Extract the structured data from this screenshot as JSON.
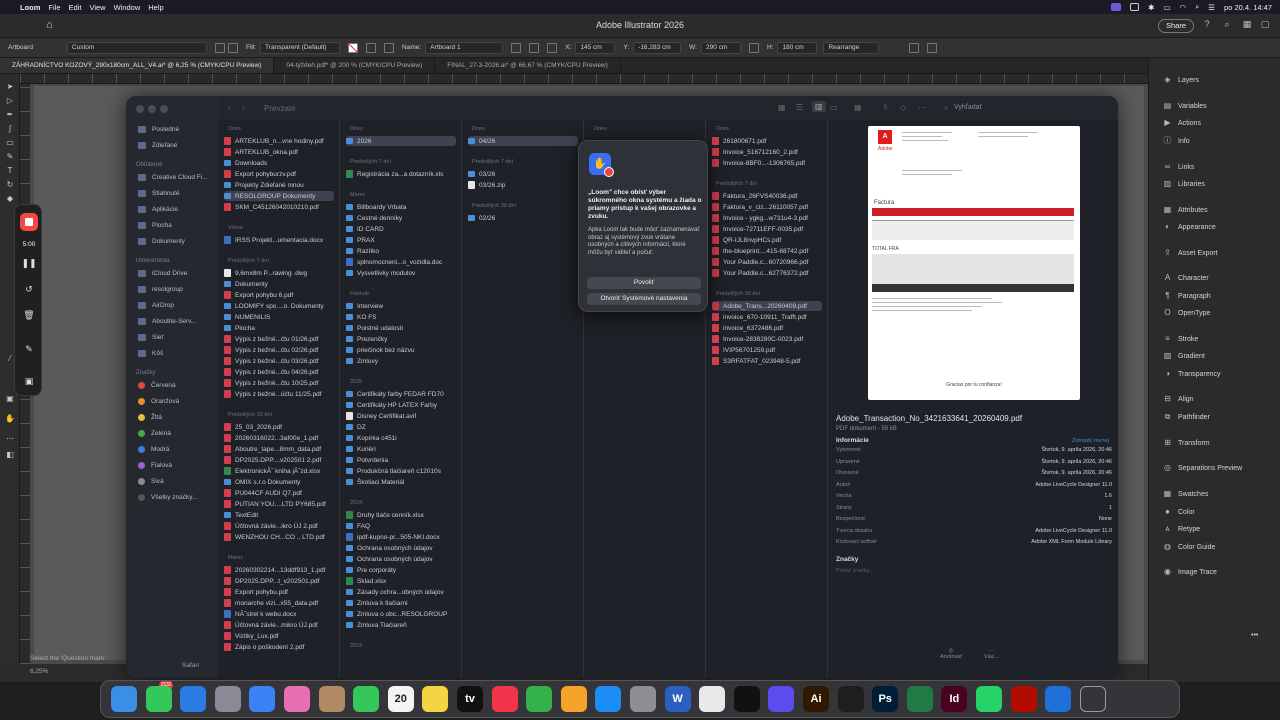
{
  "menubar": {
    "apple": "",
    "app": "Loom",
    "items": [
      "File",
      "Edit",
      "View",
      "Window",
      "Help"
    ],
    "clock": "po 20.4. 14:47"
  },
  "illustrator": {
    "title": "Adobe Illustrator 2026",
    "share": "Share",
    "control": {
      "artboard_label": "Artboard",
      "preset": "Custom",
      "fill_label": "Fill:",
      "fill_value": "Transparent (Default)",
      "name_label": "Name:",
      "name_value": "Artboard 1",
      "x_label": "X:",
      "x_value": "145 cm",
      "y_label": "Y:",
      "y_value": "-16,283 cm",
      "w_label": "W:",
      "w_value": "290 cm",
      "h_label": "H:",
      "h_value": "180 cm",
      "rearrange": "Rearrange"
    },
    "tabs": [
      "ZÁHRADNÍCTVO KOZOVÝ_290x180cm_ALL_V4.ai* @ 6,25 % (CMYK/CPU Preview)",
      "04-týždeň.pdf* @ 200 % (CMYK/CPU Preview)",
      "FINAL_27-3-2026.ai* @ 66,67 % (CMYK/CPU Preview)"
    ],
    "status": {
      "zoom": "6,25%",
      "hint": "Select the 'Question mark'"
    },
    "panels": [
      "Layers",
      "Variables",
      "Actions",
      "Info",
      "Links",
      "Libraries",
      "Attributes",
      "Appearance",
      "Asset Export",
      "Character",
      "Paragraph",
      "OpenType",
      "Stroke",
      "Gradient",
      "Transparency",
      "Align",
      "Pathfinder",
      "Transform",
      "Separations Preview",
      "Swatches",
      "Color",
      "Retype",
      "Color Guide",
      "Image Trace"
    ]
  },
  "loom": {
    "time": "5:00"
  },
  "finder": {
    "title": "Prevzaté",
    "search": "Vyhľadať",
    "sidebar": {
      "top": [
        "Posledné",
        "Zdieľané"
      ],
      "sec_places": "Obľúbené",
      "places": [
        "Creative Cloud Fi...",
        "Stiahnuté",
        "Aplikácie",
        "Plocha",
        "Dokumenty"
      ],
      "sec_locations": "Umiestnenia",
      "locations": [
        "iCloud Drive",
        "resolgroup",
        "AirDrop",
        "Aboutite-Serv...",
        "Sieť",
        "Kôš"
      ],
      "sec_tags": "Značky",
      "tags": [
        {
          "name": "Červená",
          "color": "#e0483e"
        },
        {
          "name": "Oranžová",
          "color": "#e8902f"
        },
        {
          "name": "Žltá",
          "color": "#e3c531"
        },
        {
          "name": "Zelená",
          "color": "#3fae4a"
        },
        {
          "name": "Modrá",
          "color": "#3a7ee0"
        },
        {
          "name": "Fialová",
          "color": "#a35bd6"
        },
        {
          "name": "Sivá",
          "color": "#8c8c8c"
        },
        {
          "name": "Všetky značky...",
          "color": "#555555"
        }
      ],
      "footer": "Safari"
    },
    "col1": {
      "h1": "Dnes",
      "g1": [
        "ARTEKLUB_n...vne hodiny.pdf",
        "ARTEKLUB_okna.pdf",
        "Downloads",
        "Export pohyburzv.pdf",
        "Projekty  Zdieľané mnou",
        "RESOLGROUP Dokumenty",
        "SKM_C45126042010210.pdf"
      ],
      "h2": "Včera",
      "g2": [
        "IRSS Projekt...umentacia.docx"
      ],
      "h3": "Predošlých 7 dní",
      "g3": [
        "9,6mx8m P...rawing .dwg",
        "Dokumenty",
        "Export pohybu 6.pdf",
        "LOOMIFY spo....o. Dokumenty",
        "NUMENILIS",
        "Plocha",
        "Výpis z bežné...čtu 01/26.pdf",
        "Výpis z bežné...čtu 02/26.pdf",
        "Výpis z bežné...čtu 03/26.pdf",
        "Výpis z bežné...čtu 04/26.pdf",
        "Výpis z bežné...čtu 10/25.pdf",
        "Výpis z bežné...účtu 11/25.pdf"
      ],
      "h4": "Predošlých 30 dní",
      "g4": [
        "25_03_2026.pdf",
        "20260316022...3af00e_1.pdf",
        "Aboutre_tape...8mm_data.pdf",
        "DP2025.DPP....v202501 2.pdf",
        "ElektronickĂˇ kniha jĂˇzd.xlsx",
        "OMIX s.r.o Dokumenty",
        "PU044CF AUDI Q7.pdf",
        "PUTIAN YOU....LTD PY685.pdf",
        "TextEdit",
        "Účtovná závie...ikro ÚJ 2.pdf",
        "WENZHOU CH...CO ., LTD.pdf"
      ],
      "h5": "Marec",
      "g5": [
        "20260302214...13ddf913_1.pdf",
        "DP2025.DPP...t_v202501.pdf",
        "Export pohybu.pdf",
        "monarche vizi...x55_data.pdf",
        "NĂˇstrel k webu.docx",
        "Účtovná závie...mikro ÚJ.pdf",
        "Vizitky_Lux.pdf",
        "Zápis o poškodení 2.pdf"
      ]
    },
    "col2": {
      "h1": "Dnes",
      "g1": [
        "2026"
      ],
      "h2": "Predošlých 7 dní",
      "g2": [
        "Registrácia za...a dotazník.xls"
      ],
      "h3": "Marec",
      "g3": [
        "Billboardy Vrbata",
        "Cestné denníky",
        "ID CARD",
        "PRAX",
        "Razítko",
        "splnomocneni...o_vozidla.doc",
        "Vysvetlivky modulov"
      ],
      "h4": "Február",
      "g4": [
        "Interview",
        "KO FS",
        "Poistné udalosti",
        "Prezenčky",
        "priečinok bez názvu",
        "Zmluvy"
      ],
      "h5": "2025",
      "g5": [
        "Certifikáty farby FEDAR FD70",
        "Certifikáty HP LATEX Farby",
        "Disney Certifikat.avif",
        "DZ",
        "Kopírka c451i",
        "Kuriéri",
        "Potvrdenia",
        "Produkčná tlačiareň c12010s",
        "Školiaci Materiál"
      ],
      "h6": "2024",
      "g6": [
        "Druhy tlače cenník.xlsx",
        "FAQ",
        "ipdf-kupno-pr...505-NKI.docx",
        "Ochrana osobných údajov",
        "Ochrana osobných údajov",
        "Pre corporáty",
        "Sklad.xlsx",
        "Zásady ochra...obných údajov",
        "Zmluva k tlačiarni",
        "Zmluva o obc...RESOLGROUP",
        "Zmluva Tlačiareň"
      ],
      "h7": "2023"
    },
    "col3": {
      "h1": "Dnes",
      "g1": [
        "04/26"
      ],
      "h2": "Predošlých 7 dní",
      "g2": [
        "03/26",
        "03/26.zip"
      ],
      "h3": "Predošlých 30 dní",
      "g3": [
        "02/26"
      ]
    },
    "col4": {
      "h1": "Dnes"
    },
    "col5": {
      "h1": "Dnes",
      "g1": [
        "261800671.pdf",
        "Invoice_516712160_2.pdf",
        "Invoice-8BF0...-1306765.pdf"
      ],
      "h2": "Predošlých 7 dní",
      "g2": [
        "Faktura_26FVS40036.pdf",
        "Faktura_v_ciz...26110057.pdf",
        "Invoice - ygkg...w731u4-3.pdf",
        "Invoice-72711EFF-0035.pdf",
        "QR-IJL8nvpHCs.pdf",
        "the-blueprint....415-68742.pdf",
        "Your Paddle.c...60720966.pdf",
        "Your Paddle.c...62776372.pdf"
      ],
      "h3": "Predošlých 30 dní",
      "g3": [
        "Adobe_Trans...20260409.pdf",
        "invoice_670-10911_Trafft.pdf",
        "invoice_6372486.pdf",
        "Invoice-2838280C-0023.pdf",
        "IVIP56701259.pdf",
        "S3RFATFAT_023948-5.pdf"
      ]
    },
    "dialog": {
      "title": "„Loom\" chce obísť výber súkromného okna systému a žiada o priamy prístup k vašej obrazovke a zvuku.",
      "body": "Apka Loom tak bude môcť zaznamenávať obraz aj systémový zvuk vrátane osobných a citlivých informácií, ktoré môžu byť viditeľ a počuť.",
      "allow": "Povoliť",
      "settings": "Otvoriť Systémové nastavenia"
    },
    "preview": {
      "logo": "A",
      "brand": "Adobe",
      "heading": "Factura",
      "total": "TOTAL FRA",
      "thanks": "Gracias por tu confianza!",
      "filename": "Adobe_Transaction_No_3421633641_20260409.pdf",
      "kind": "PDF dokument - 59 kB",
      "info_h": "Informácie",
      "info_more": "Zobraziť menej",
      "info": [
        {
          "k": "Vytvorené",
          "v": "Štvrtok, 9. apríla 2026, 20:46"
        },
        {
          "k": "Upravené",
          "v": "Štvrtok, 9. apríla 2026, 20:46"
        },
        {
          "k": "Otvorené",
          "v": "Štvrtok, 9. apríla 2026, 20:46"
        },
        {
          "k": "Autori",
          "v": "Adobe LiveCycle Designer 11.0"
        },
        {
          "k": "Verzia",
          "v": "1.6"
        },
        {
          "k": "Strany",
          "v": "1"
        },
        {
          "k": "Bezpečnosť",
          "v": "None"
        },
        {
          "k": "Tvorca obsahu",
          "v": "Adobe LiveCycle Designer 11.0"
        },
        {
          "k": "Kódovací softvér",
          "v": "Adobe XML Form Module Library"
        }
      ],
      "tags_h": "Značky",
      "tags_add": "Pridať značky...",
      "act1": "Anotovať",
      "act2": "Viac..."
    }
  },
  "dock": {
    "badge": "1532",
    "calendar_day": "20",
    "apps": [
      {
        "name": "finder",
        "color": "#3a8ee6",
        "glyph": ""
      },
      {
        "name": "messages",
        "color": "#34c759",
        "glyph": ""
      },
      {
        "name": "safari",
        "color": "#2a7be4",
        "glyph": ""
      },
      {
        "name": "launchpad",
        "color": "#8a8a96",
        "glyph": ""
      },
      {
        "name": "mail",
        "color": "#3b82f6",
        "glyph": ""
      },
      {
        "name": "photos",
        "color": "#e96fb3",
        "glyph": ""
      },
      {
        "name": "contacts",
        "color": "#b08a62",
        "glyph": ""
      },
      {
        "name": "facetime",
        "color": "#34c759",
        "glyph": ""
      },
      {
        "name": "calendar",
        "color": "#f4f4f4",
        "glyph": ""
      },
      {
        "name": "notes",
        "color": "#f5d442",
        "glyph": ""
      },
      {
        "name": "tv",
        "color": "#111111",
        "glyph": "tv"
      },
      {
        "name": "music",
        "color": "#f2354b",
        "glyph": ""
      },
      {
        "name": "numbers",
        "color": "#32b14a",
        "glyph": ""
      },
      {
        "name": "pages",
        "color": "#f6a32b",
        "glyph": ""
      },
      {
        "name": "app-store",
        "color": "#1e8cf5",
        "glyph": ""
      },
      {
        "name": "system-settings",
        "color": "#8e8e93",
        "glyph": ""
      },
      {
        "name": "word",
        "color": "#2b5fc0",
        "glyph": "W"
      },
      {
        "name": "preview",
        "color": "#e8e8e8",
        "glyph": ""
      },
      {
        "name": "chatgpt",
        "color": "#111111",
        "glyph": ""
      },
      {
        "name": "loom",
        "color": "#5b4cf0",
        "glyph": ""
      },
      {
        "name": "illustrator",
        "color": "#2d1a00",
        "glyph": "Ai"
      },
      {
        "name": "figma",
        "color": "#1e1e1e",
        "glyph": ""
      },
      {
        "name": "photoshop",
        "color": "#001e36",
        "glyph": "Ps"
      },
      {
        "name": "excel",
        "color": "#1f7a43",
        "glyph": ""
      },
      {
        "name": "indesign",
        "color": "#49021f",
        "glyph": "Id"
      },
      {
        "name": "whatsapp",
        "color": "#25d366",
        "glyph": ""
      },
      {
        "name": "acrobat",
        "color": "#b30b00",
        "glyph": ""
      },
      {
        "name": "settings-gear",
        "color": "#1f6fd9",
        "glyph": ""
      },
      {
        "name": "trash",
        "color": "#9a9a9a",
        "glyph": ""
      }
    ]
  }
}
